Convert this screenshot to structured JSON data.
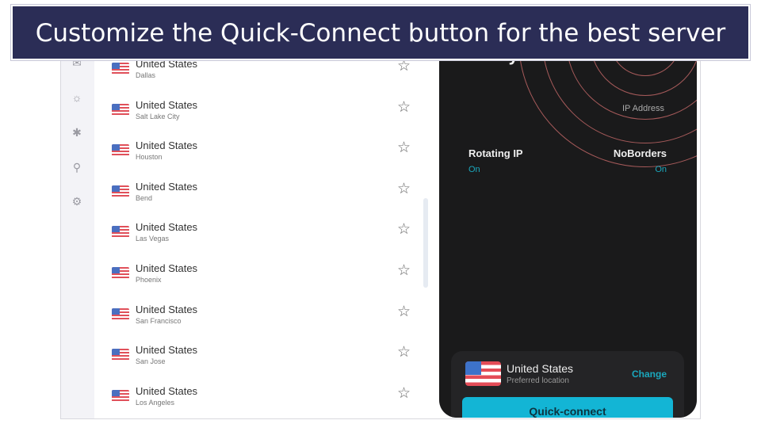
{
  "banner": {
    "title": "Customize the Quick-Connect button for the best server"
  },
  "sidebar": {
    "icons": [
      "mail-icon",
      "alert-icon",
      "bug-icon",
      "search-minus-icon",
      "gear-icon"
    ]
  },
  "servers": [
    {
      "country": "United States",
      "city": "Dallas"
    },
    {
      "country": "United States",
      "city": "Salt Lake City"
    },
    {
      "country": "United States",
      "city": "Houston"
    },
    {
      "country": "United States",
      "city": "Bend"
    },
    {
      "country": "United States",
      "city": "Las Vegas"
    },
    {
      "country": "United States",
      "city": "Phoenix"
    },
    {
      "country": "United States",
      "city": "San Francisco"
    },
    {
      "country": "United States",
      "city": "San Jose"
    },
    {
      "country": "United States",
      "city": "Los Angeles"
    }
  ],
  "panel": {
    "headline": "to stay safe",
    "ip_label": "IP Address",
    "rotating_ip": {
      "label": "Rotating IP",
      "value": "On"
    },
    "noborders": {
      "label": "NoBorders",
      "value": "On"
    },
    "preferred": {
      "country": "United States",
      "subtitle": "Preferred location",
      "change": "Change"
    },
    "quick_connect": "Quick-connect"
  },
  "colors": {
    "accent": "#13b5d5",
    "banner": "#2b2d56",
    "panel": "#1a1a1b",
    "alert": "#f25a68"
  }
}
